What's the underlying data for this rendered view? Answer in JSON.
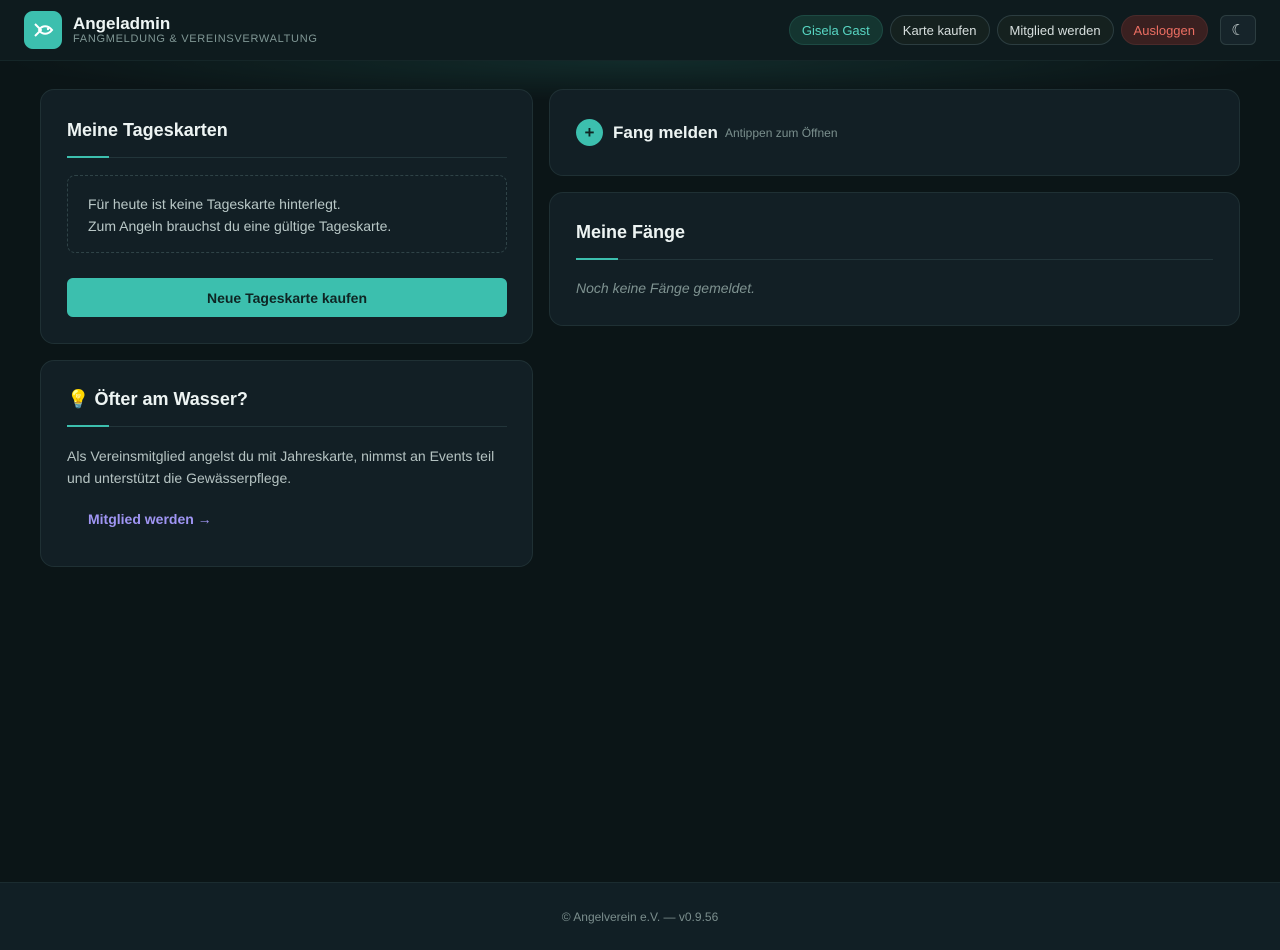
{
  "header": {
    "title": "Angeladmin",
    "subtitle": "FANGMELDUNG & VEREINSVERWALTUNG",
    "user": "Gisela Gast",
    "nav": {
      "buy_card": "Karte kaufen",
      "become_member": "Mitglied werden",
      "logout": "Ausloggen"
    },
    "theme_toggle_icon": "☾"
  },
  "day_cards": {
    "title": "Meine Tageskarten",
    "empty_line1": "Für heute ist keine Tageskarte hinterlegt.",
    "empty_line2": "Zum Angeln brauchst du eine gültige Tageskarte.",
    "buy_button": "Neue Tageskarte kaufen"
  },
  "promo": {
    "icon": "💡",
    "title": "Öfter am Wasser?",
    "text": "Als Vereinsmitglied angelst du mit Jahreskarte, nimmst an Events teil und unterstützt die Gewässerpflege.",
    "link": "Mitglied werden →"
  },
  "report_catch": {
    "icon": "+",
    "title": "Fang melden",
    "hint": "Antippen zum Öffnen"
  },
  "my_catches": {
    "title": "Meine Fänge",
    "empty": "Noch keine Fänge gemeldet."
  },
  "footer": {
    "text": "© Angelverein e.V. — v0.9.56"
  },
  "colors": {
    "accent": "#3cbfae",
    "background": "#0b1517",
    "card": "#121f25",
    "logout": "#ec6e62",
    "link": "#9f95f3"
  }
}
